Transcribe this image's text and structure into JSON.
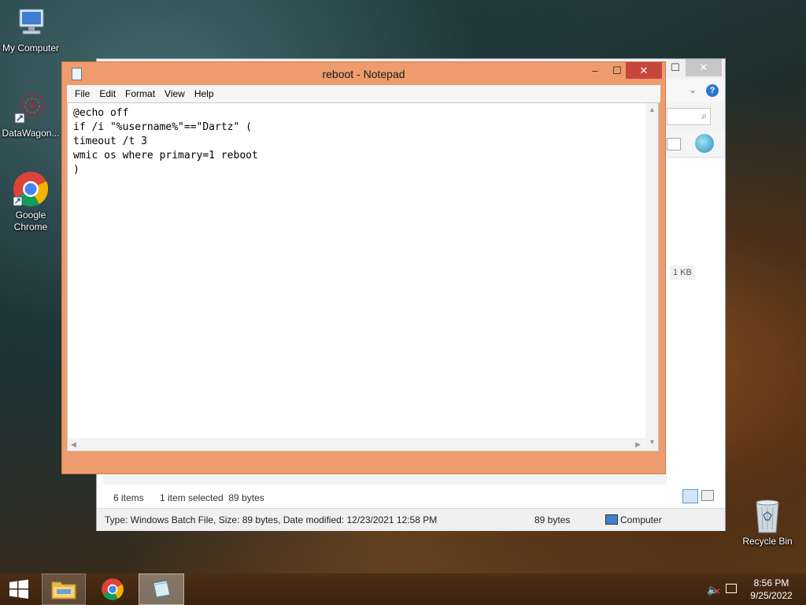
{
  "desktop": {
    "icons": [
      {
        "label": "My Computer"
      },
      {
        "label": "DataWagon..."
      },
      {
        "label": "Google Chrome"
      },
      {
        "label": "Recycle Bin"
      }
    ]
  },
  "explorer": {
    "size_label": "1 KB",
    "status": {
      "items": "6 items",
      "selected": "1 item selected  89 bytes"
    },
    "info": {
      "details": "Type: Windows Batch File, Size: 89 bytes, Date modified: 12/23/2021 12:58 PM",
      "size": "89 bytes",
      "location": "Computer"
    },
    "buttons": {
      "minimize": "–",
      "maximize": "☐",
      "close": "✕",
      "help": "?"
    }
  },
  "notepad": {
    "title": "reboot - Notepad",
    "menu": [
      "File",
      "Edit",
      "Format",
      "View",
      "Help"
    ],
    "content": "@echo off\nif /i \"%username%\"==\"Dartz\" (\ntimeout /t 3\nwmic os where primary=1 reboot\n)",
    "buttons": {
      "minimize": "–",
      "maximize": "☐",
      "close": "✕"
    }
  },
  "taskbar": {
    "time": "8:56 PM",
    "date": "9/25/2022"
  },
  "colors": {
    "notepad_frame": "#ee9c6e",
    "close_button": "#c7463b",
    "taskbar": "#3a230f"
  }
}
